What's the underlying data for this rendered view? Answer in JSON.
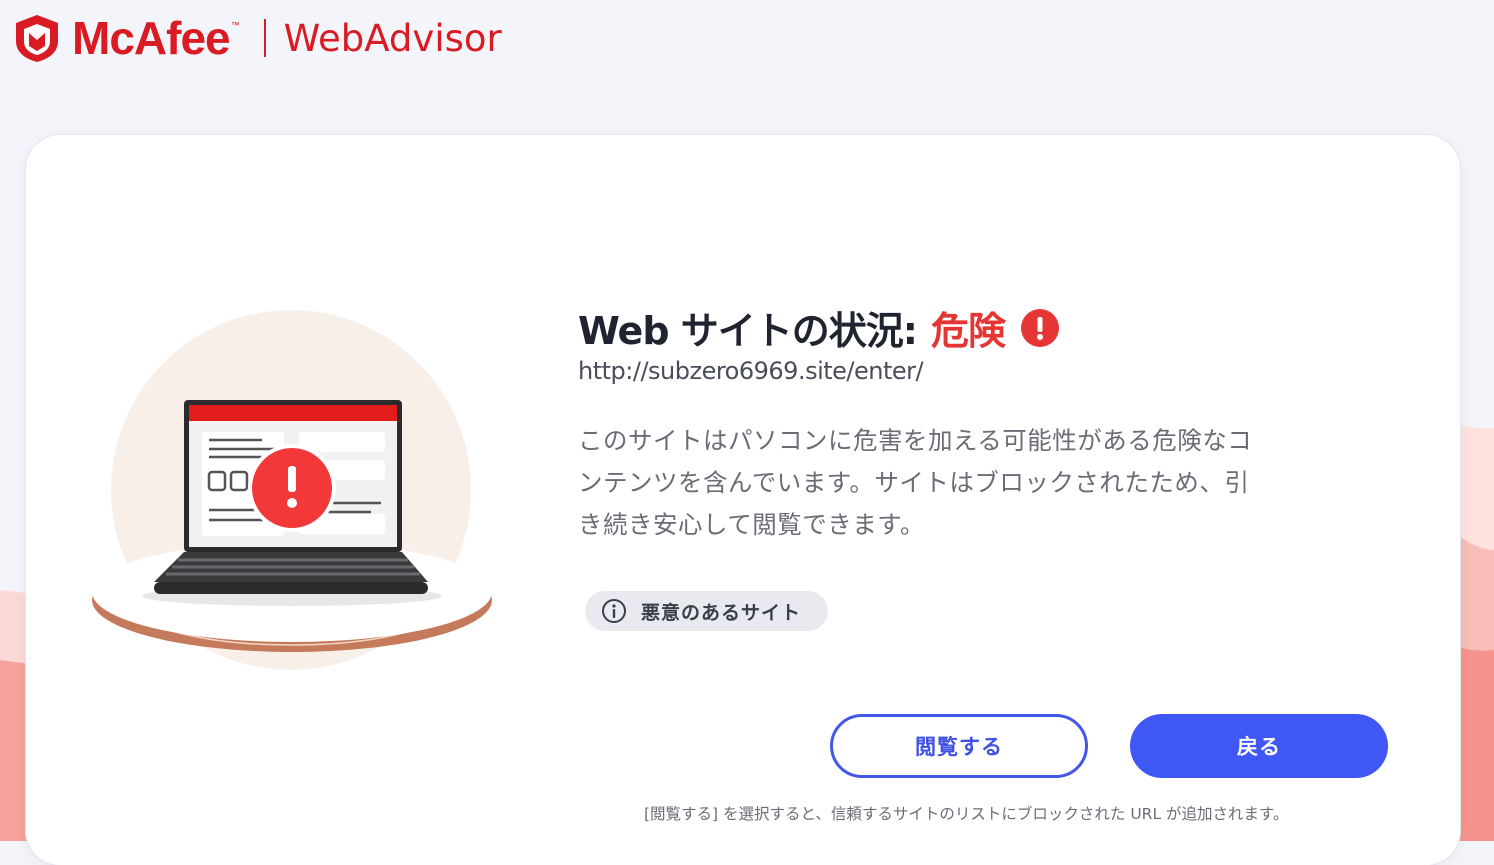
{
  "header": {
    "brand_name": "McAfee",
    "trademark": "™",
    "product_name": "WebAdvisor",
    "brand_color": "#d91c23"
  },
  "status": {
    "title": "Web サイトの状況:",
    "level": "危険",
    "level_color": "#e53535",
    "icon": "exclamation-circle-icon"
  },
  "site": {
    "url": "http://subzero6969.site/enter/"
  },
  "description": "このサイトはパソコンに危害を加える可能性がある危険なコンテンツを含んでいます。サイトはブロックされたため、引き続き安心して閲覧できます。",
  "category_chip": {
    "icon": "info-icon",
    "label": "悪意のあるサイト"
  },
  "actions": {
    "visit_label": "閲覧する",
    "back_label": "戻る",
    "primary_color": "#3f57f5"
  },
  "footnote": "[閲覧する] を選択すると、信頼するサイトのリストにブロックされた URL が追加されます。"
}
